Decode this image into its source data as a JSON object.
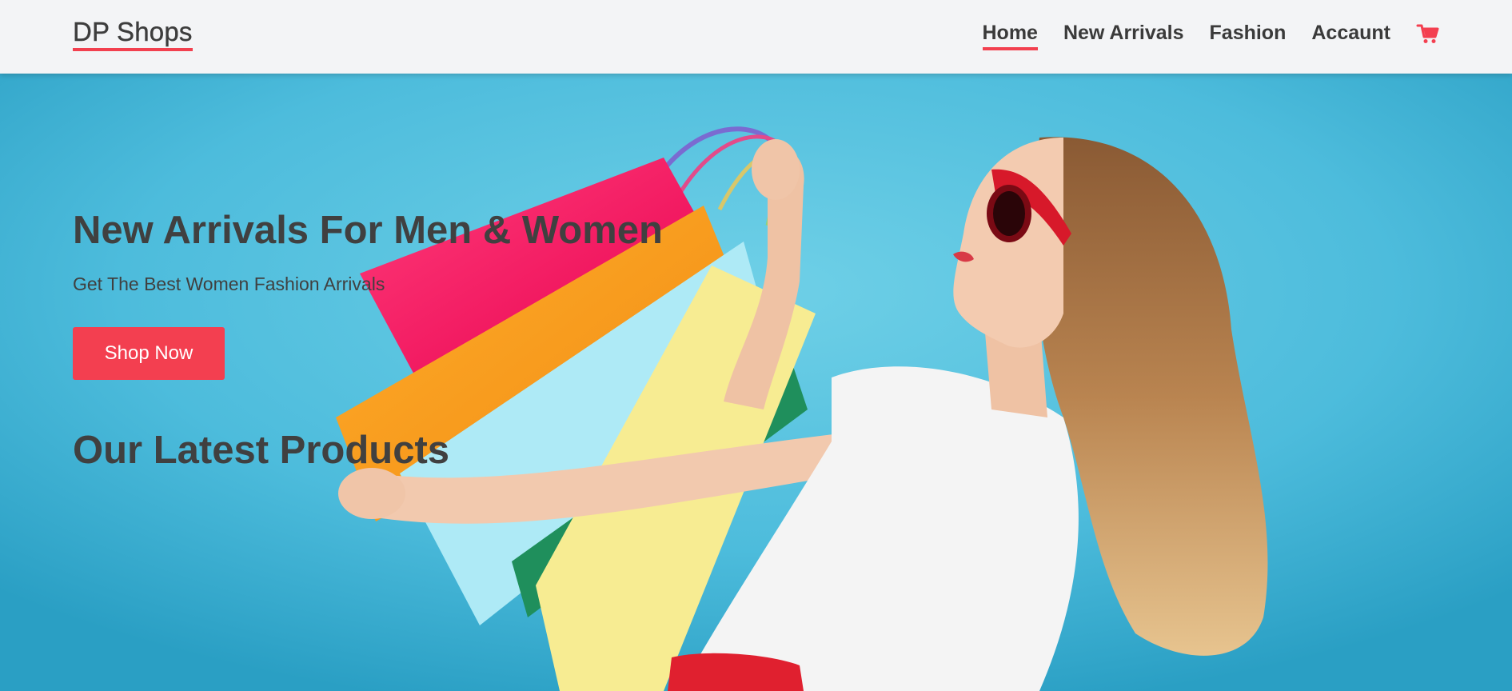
{
  "header": {
    "logo": "DP Shops",
    "nav": [
      {
        "label": "Home",
        "active": true
      },
      {
        "label": "New Arrivals",
        "active": false
      },
      {
        "label": "Fashion",
        "active": false
      },
      {
        "label": "Accaunt",
        "active": false
      }
    ],
    "cart_icon": "shopping-cart-icon"
  },
  "hero": {
    "title": "New Arrivals For Men & Women",
    "subtitle": "Get The Best Women Fashion Arrivals",
    "cta_label": "Shop Now",
    "image": "woman-with-shopping-bags-photo"
  },
  "products": {
    "title": "Our Latest Products"
  },
  "colors": {
    "accent": "#f33f50",
    "header_bg": "#f3f4f6",
    "hero_bg": "#4fbadb",
    "text": "#404040"
  }
}
